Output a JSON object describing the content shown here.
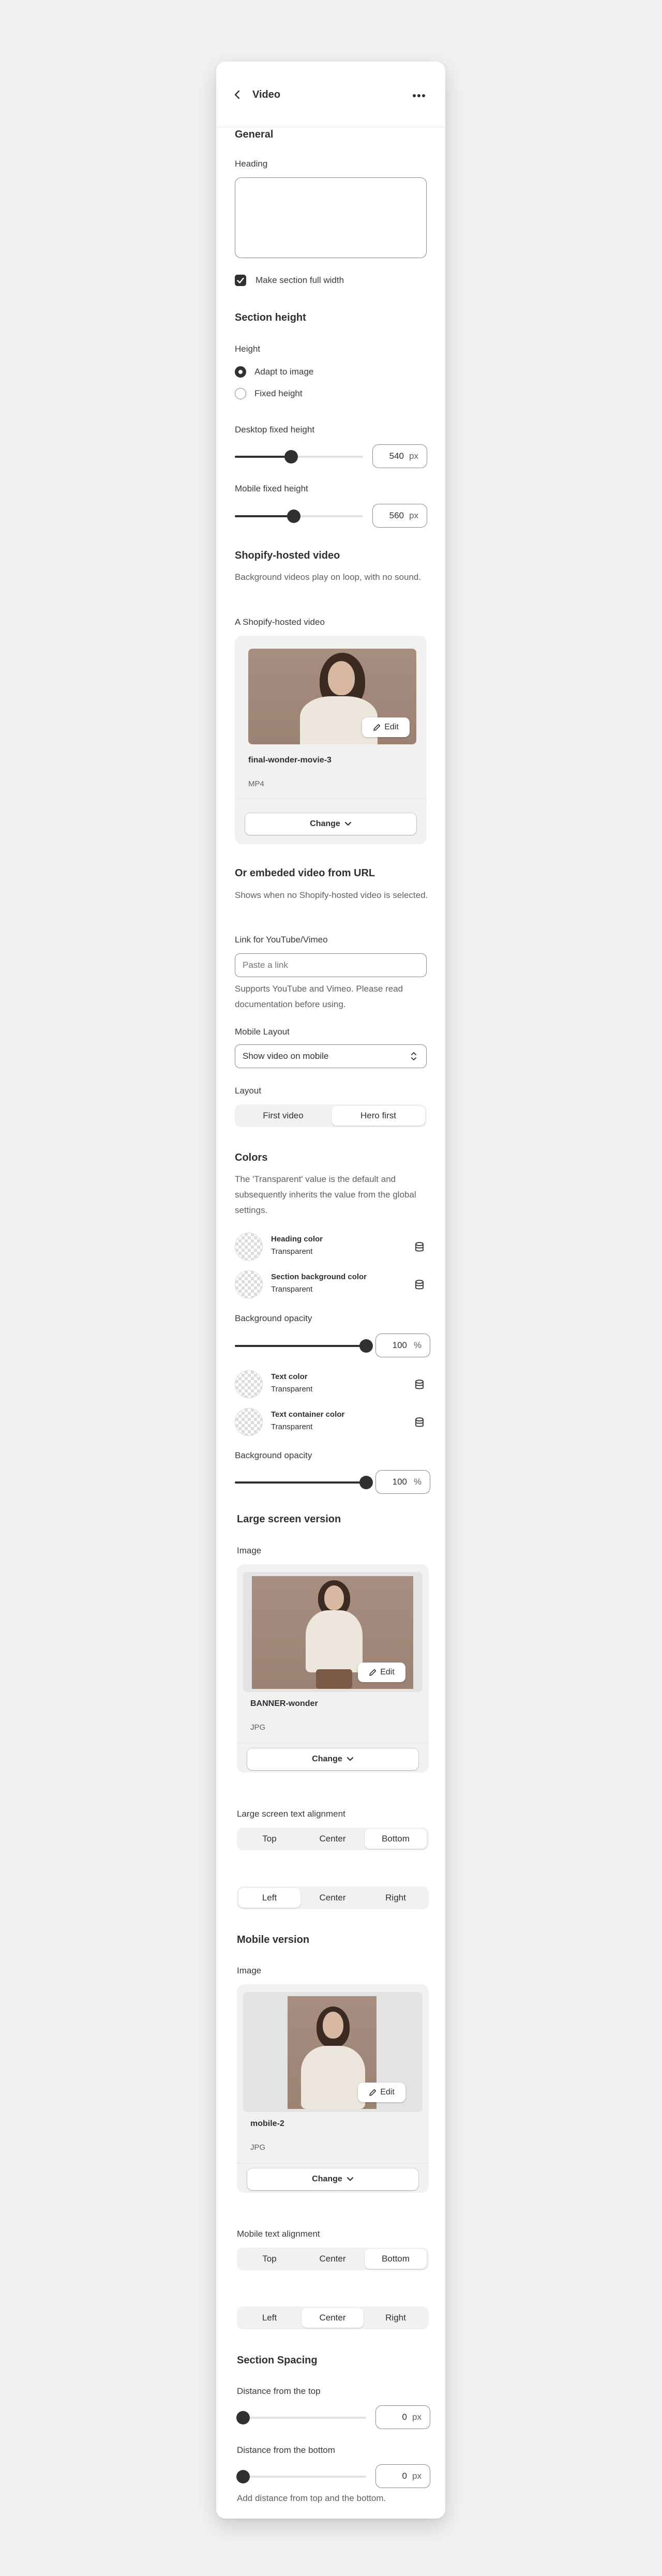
{
  "header": {
    "back_label": "Video",
    "more_icon": "more-horizontal-icon"
  },
  "general": {
    "title": "General",
    "heading_label": "Heading",
    "heading_value": "",
    "full_width_label": "Make section full width",
    "full_width_checked": true
  },
  "section_height": {
    "title": "Section height",
    "height_label": "Height",
    "options": [
      "Adapt to image",
      "Fixed height"
    ],
    "selected": "Adapt to image",
    "desktop": {
      "label": "Desktop fixed height",
      "value": "540",
      "unit": "px",
      "fraction": 0.44
    },
    "mobile": {
      "label": "Mobile fixed height",
      "value": "560",
      "unit": "px",
      "fraction": 0.46
    }
  },
  "shopify_video": {
    "title": "Shopify-hosted video",
    "description": "Background videos play on loop, with no sound.",
    "field_label": "A Shopify-hosted video",
    "file_name": "final-wonder-movie-3",
    "file_type": "MP4",
    "edit_label": "Edit",
    "change_label": "Change"
  },
  "embed_video": {
    "title": "Or embeded video from URL",
    "description": "Shows when no Shopify-hosted video is selected.",
    "link_label": "Link for YouTube/Vimeo",
    "link_placeholder": "Paste a link",
    "link_help": "Supports YouTube and Vimeo. Please read documentation before using.",
    "mobile_layout_label": "Mobile Layout",
    "mobile_layout_value": "Show video on mobile",
    "layout_label": "Layout",
    "layout_options": [
      "First video",
      "Hero first"
    ],
    "layout_selected": "Hero first"
  },
  "colors": {
    "title": "Colors",
    "description": "The 'Transparent' value is the default and subsequently inherits the value from the global settings.",
    "items": [
      {
        "name": "Heading color",
        "value": "Transparent"
      },
      {
        "name": "Section background color",
        "value": "Transparent"
      },
      {
        "name": "Text color",
        "value": "Transparent"
      },
      {
        "name": "Text container color",
        "value": "Transparent"
      }
    ],
    "bg_opacity_1": {
      "label": "Background opacity",
      "value": "100",
      "unit": "%",
      "fraction": 1.0
    },
    "bg_opacity_2": {
      "label": "Background opacity",
      "value": "100",
      "unit": "%",
      "fraction": 1.0
    }
  },
  "large_screen": {
    "title": "Large screen version",
    "image_label": "Image",
    "file_name": "BANNER-wonder",
    "file_type": "JPG",
    "edit_label": "Edit",
    "change_label": "Change",
    "align_label": "Large screen text alignment",
    "v_options": [
      "Top",
      "Center",
      "Bottom"
    ],
    "v_selected": "Bottom",
    "h_options": [
      "Left",
      "Center",
      "Right"
    ],
    "h_selected": "Left"
  },
  "mobile_version": {
    "title": "Mobile version",
    "image_label": "Image",
    "file_name": "mobile-2",
    "file_type": "JPG",
    "edit_label": "Edit",
    "change_label": "Change",
    "align_label": "Mobile text alignment",
    "v_options": [
      "Top",
      "Center",
      "Bottom"
    ],
    "v_selected": "Bottom",
    "h_options": [
      "Left",
      "Center",
      "Right"
    ],
    "h_selected": "Center"
  },
  "spacing": {
    "title": "Section Spacing",
    "top": {
      "label": "Distance from the top",
      "value": "0",
      "unit": "px",
      "fraction": 0
    },
    "bottom": {
      "label": "Distance from the bottom",
      "value": "0",
      "unit": "px",
      "fraction": 0
    },
    "help": "Add distance from top and the bottom."
  },
  "colors_theme": {
    "accent": "#303030",
    "panel": "#ffffff",
    "background": "#f1f1f1"
  }
}
